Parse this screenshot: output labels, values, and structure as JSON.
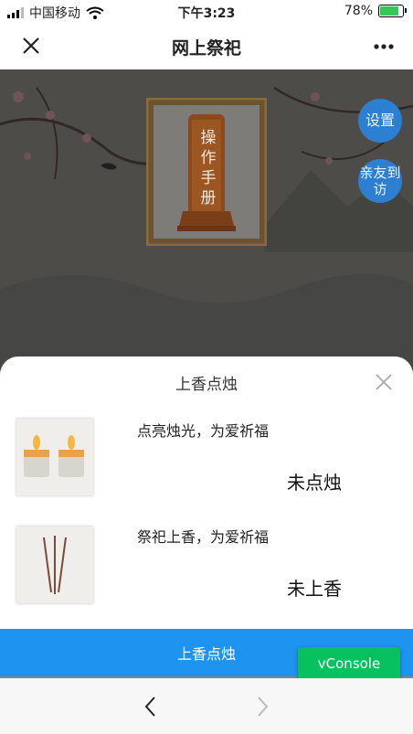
{
  "status_bar": {
    "carrier": "中国移动",
    "time": "下午3:23",
    "battery": "78%",
    "battery_level": 0.78
  },
  "nav": {
    "title": "网上祭祀"
  },
  "scene": {
    "manual_text": "操作手册",
    "settings_label": "设置",
    "visit_label": "亲友到访"
  },
  "sheet": {
    "title": "上香点烛",
    "items": [
      {
        "desc": "点亮烛光，为爱祈福",
        "status": "未点烛"
      },
      {
        "desc": "祭祀上香，为爱祈福",
        "status": "未上香"
      }
    ]
  },
  "action": {
    "label": "上香点烛"
  },
  "vconsole": {
    "label": "vConsole"
  },
  "colors": {
    "action_blue": "#1f93f0",
    "vconsole_green": "#07c160",
    "side_button_blue": "#2d7fd2"
  }
}
